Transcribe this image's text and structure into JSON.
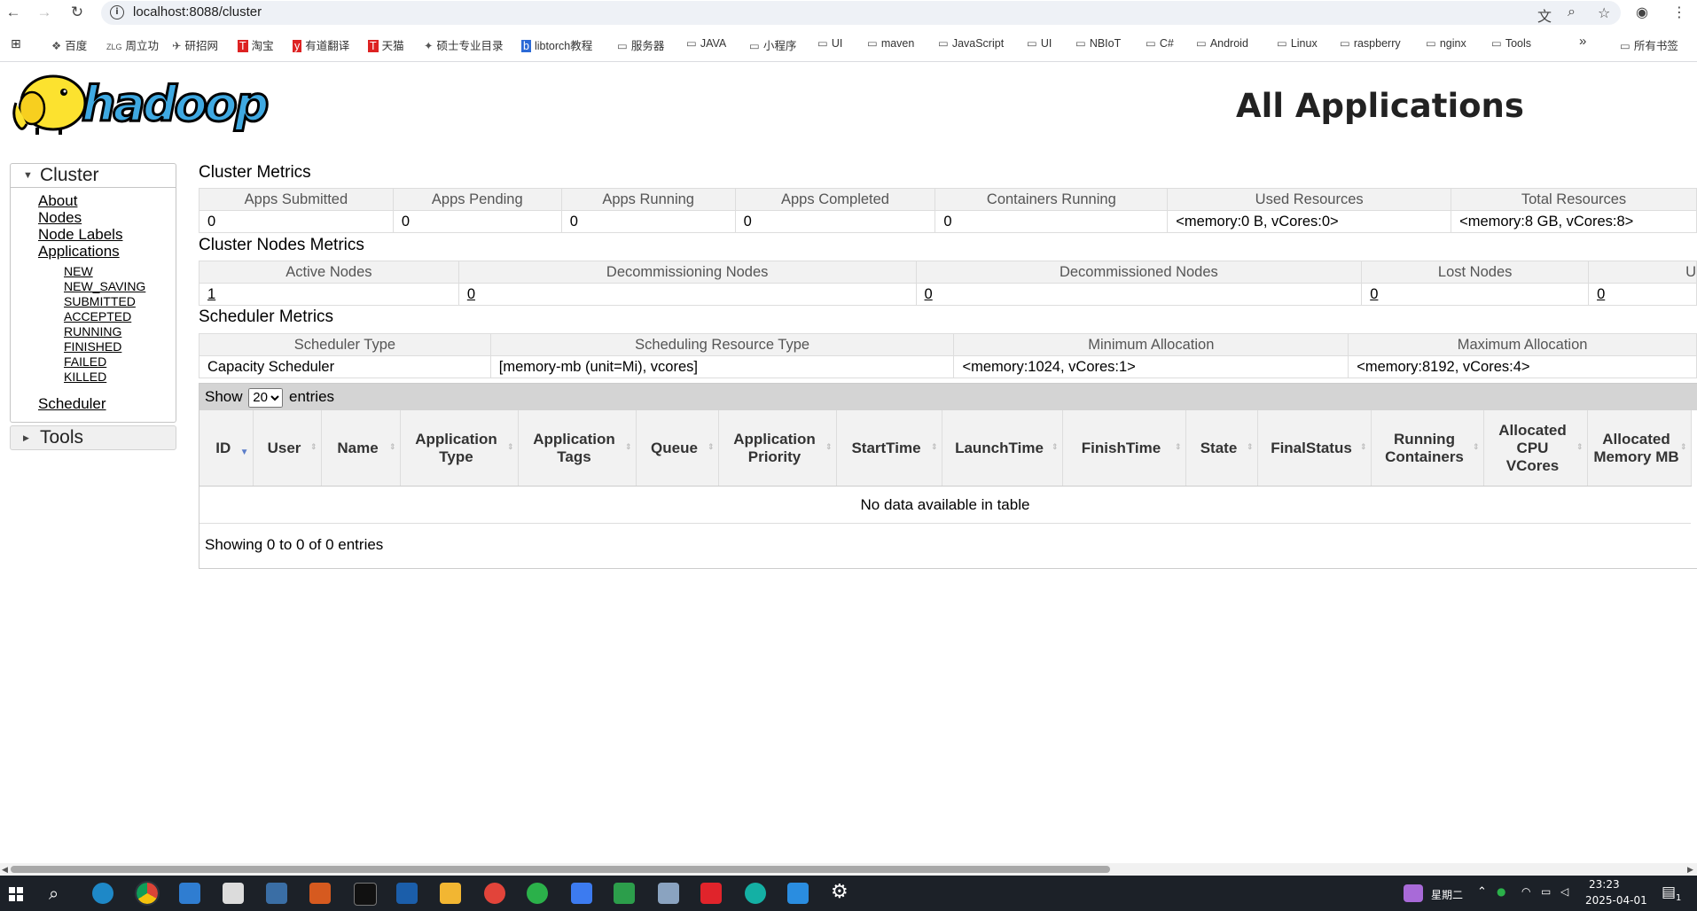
{
  "browser": {
    "url": "localhost:8088/cluster",
    "bookmarks": [
      "百度",
      "周立功",
      "研招网",
      "淘宝",
      "有道翻译",
      "天猫",
      "硕士专业目录",
      "libtorch教程",
      "服务器",
      "JAVA",
      "小程序",
      "UI",
      "maven",
      "JavaScript",
      "UI",
      "NBIoT",
      "C#",
      "Android",
      "Linux",
      "raspberry",
      "nginx",
      "Tools"
    ],
    "bookmarks_overflow": "»",
    "all_bookmarks": "所有书签"
  },
  "header": {
    "logo_text": "hadoop",
    "title": "All Applications"
  },
  "sidebar": {
    "cluster_label": "Cluster",
    "links": [
      "About",
      "Nodes",
      "Node Labels",
      "Applications"
    ],
    "app_states": [
      "NEW",
      "NEW_SAVING",
      "SUBMITTED",
      "ACCEPTED",
      "RUNNING",
      "FINISHED",
      "FAILED",
      "KILLED"
    ],
    "scheduler": "Scheduler",
    "tools_label": "Tools"
  },
  "cluster_metrics": {
    "title": "Cluster Metrics",
    "headers": [
      "Apps Submitted",
      "Apps Pending",
      "Apps Running",
      "Apps Completed",
      "Containers Running",
      "Used Resources",
      "Total Resources"
    ],
    "values": [
      "0",
      "0",
      "0",
      "0",
      "0",
      "<memory:0 B, vCores:0>",
      "<memory:8 GB, vCores:8>"
    ]
  },
  "node_metrics": {
    "title": "Cluster Nodes Metrics",
    "headers": [
      "Active Nodes",
      "Decommissioning Nodes",
      "Decommissioned Nodes",
      "Lost Nodes",
      "U"
    ],
    "values": [
      "1",
      "0",
      "0",
      "0",
      "0"
    ]
  },
  "scheduler_metrics": {
    "title": "Scheduler Metrics",
    "headers": [
      "Scheduler Type",
      "Scheduling Resource Type",
      "Minimum Allocation",
      "Maximum Allocation"
    ],
    "values": [
      "Capacity Scheduler",
      "[memory-mb (unit=Mi), vcores]",
      "<memory:1024, vCores:1>",
      "<memory:8192, vCores:4>"
    ]
  },
  "apps": {
    "show_label": "Show",
    "entries_label": "entries",
    "page_size": "20",
    "columns": [
      "ID",
      "User",
      "Name",
      "Application Type",
      "Application Tags",
      "Queue",
      "Application Priority",
      "StartTime",
      "LaunchTime",
      "FinishTime",
      "State",
      "FinalStatus",
      "Running Containers",
      "Allocated CPU VCores",
      "Allocated Memory MB"
    ],
    "empty_message": "No data available in table",
    "info": "Showing 0 to 0 of 0 entries"
  },
  "taskbar": {
    "weekday": "星期二",
    "time": "23:23",
    "date": "2025-04-01",
    "notifications": "1"
  },
  "colors": {
    "accent": "#5b7dc9",
    "taskbar": "#1c2128",
    "header_bg": "#f2f2f2"
  }
}
